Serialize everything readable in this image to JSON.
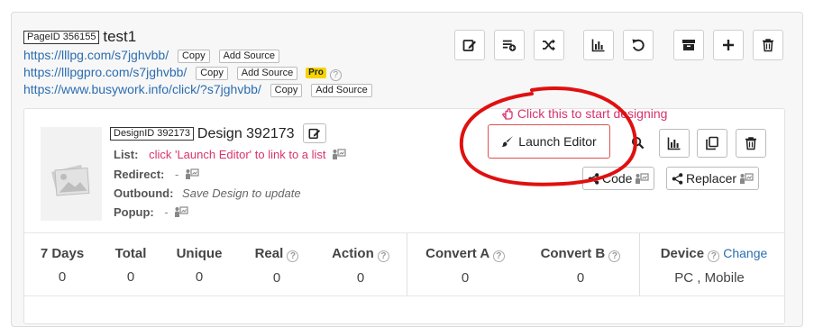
{
  "page": {
    "id_label": "PageID 356155",
    "title": "test1",
    "links": [
      {
        "url": "https://lllpg.com/s7jghvbb/",
        "copy": "Copy",
        "add_source": "Add Source",
        "badge": ""
      },
      {
        "url": "https://lllpgpro.com/s7jghvbb/",
        "copy": "Copy",
        "add_source": "Add Source",
        "badge": "Pro"
      },
      {
        "url": "https://www.busywork.info/click/?s7jghvbb/",
        "copy": "Copy",
        "add_source": "Add Source",
        "badge": ""
      }
    ],
    "toolbar_icons": [
      "edit-icon",
      "add-to-list-icon",
      "shuffle-icon",
      "stats-icon",
      "undo-icon",
      "archive-icon",
      "plus-icon",
      "trash-icon"
    ]
  },
  "design": {
    "id_label": "DesignID 392173",
    "title": "Design 392173",
    "list_label": "List:",
    "list_value": "click 'Launch Editor' to link to a list",
    "redirect_label": "Redirect:",
    "redirect_value": "-",
    "outbound_label": "Outbound:",
    "outbound_value": "Save Design to update",
    "popup_label": "Popup:",
    "popup_value": "-",
    "hint": "Click this to start designing",
    "launch_editor": "Launch Editor",
    "code_label": "Code",
    "replacer_label": "Replacer"
  },
  "stats": {
    "columns": [
      {
        "label": "7 Days",
        "value": "0",
        "help": false
      },
      {
        "label": "Total",
        "value": "0",
        "help": false
      },
      {
        "label": "Unique",
        "value": "0",
        "help": false
      },
      {
        "label": "Real",
        "value": "0",
        "help": true
      },
      {
        "label": "Action",
        "value": "0",
        "help": true
      },
      {
        "label": "Convert A",
        "value": "0",
        "help": true
      },
      {
        "label": "Convert B",
        "value": "0",
        "help": true
      },
      {
        "label": "Device",
        "value": "PC , Mobile",
        "help": true
      }
    ],
    "change_link": "Change"
  },
  "colors": {
    "accent_link": "#2a6db0",
    "hint_pink": "#d8336a",
    "annotation_red": "#e01010",
    "pro_badge": "#f5d400"
  }
}
